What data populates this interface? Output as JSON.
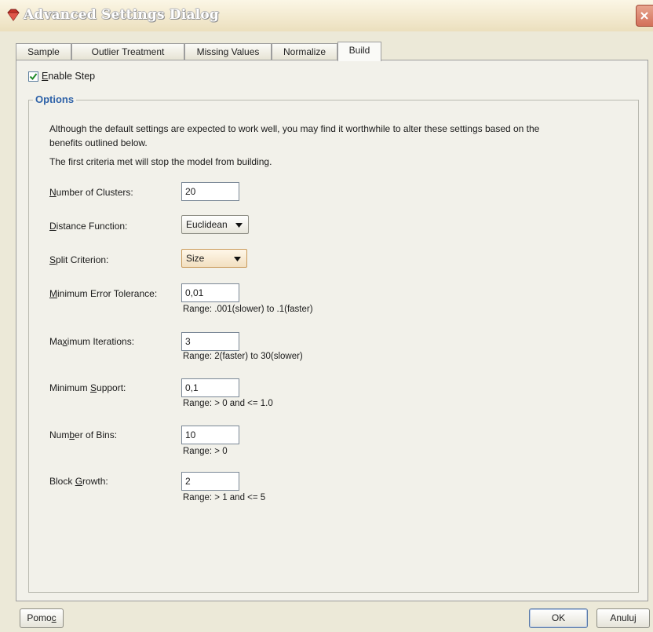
{
  "window": {
    "title": "Advanced Settings Dialog",
    "icon": "diamond-app-icon",
    "close_icon": "close-icon"
  },
  "tabs": [
    {
      "label": "Sample",
      "active": false
    },
    {
      "label": "Outlier Treatment",
      "active": false
    },
    {
      "label": "Missing Values",
      "active": false
    },
    {
      "label": "Normalize",
      "active": false
    },
    {
      "label": "Build",
      "active": true
    }
  ],
  "enable_step": {
    "checked": true,
    "mnemonic": "E",
    "rest": "nable Step"
  },
  "options": {
    "legend": "Options",
    "description_line1": "Although the default settings are expected to work well, you may find it worthwhile to alter these settings based on the",
    "description_line2": "benefits outlined below.",
    "criteria_note": "The first criteria met will stop the model from building.",
    "fields": {
      "num_clusters": {
        "mnemonic": "N",
        "rest": "umber of Clusters:",
        "value": "20"
      },
      "distance_function": {
        "mnemonic": "D",
        "rest": "istance Function:",
        "value": "Euclidean"
      },
      "split_criterion": {
        "mnemonic": "S",
        "rest": "plit Criterion:",
        "value": "Size"
      },
      "min_error": {
        "mnemonic": "M",
        "rest": "inimum Error Tolerance:",
        "value": "0,01",
        "range": "Range: .001(slower) to .1(faster)"
      },
      "max_iterations": {
        "pre": "Ma",
        "mnemonic": "x",
        "rest": "imum Iterations:",
        "value": "3",
        "range": "Range: 2(faster) to 30(slower)"
      },
      "min_support": {
        "pre": "Minimum ",
        "mnemonic": "S",
        "rest": "upport:",
        "value": "0,1",
        "range": "Range: > 0 and <= 1.0"
      },
      "num_bins": {
        "pre": "Num",
        "mnemonic": "b",
        "rest": "er of Bins:",
        "value": "10",
        "range": "Range: > 0"
      },
      "block_growth": {
        "pre": "Block ",
        "mnemonic": "G",
        "rest": "rowth:",
        "value": "2",
        "range": "Range: > 1 and <= 5"
      }
    }
  },
  "buttons": {
    "help": {
      "pre": "Pomo",
      "mnemonic": "c"
    },
    "ok": "OK",
    "cancel": "Anuluj"
  },
  "colors": {
    "legend": "#2e62a8",
    "background": "#f2f1ea",
    "close_button": "#d2705a"
  }
}
